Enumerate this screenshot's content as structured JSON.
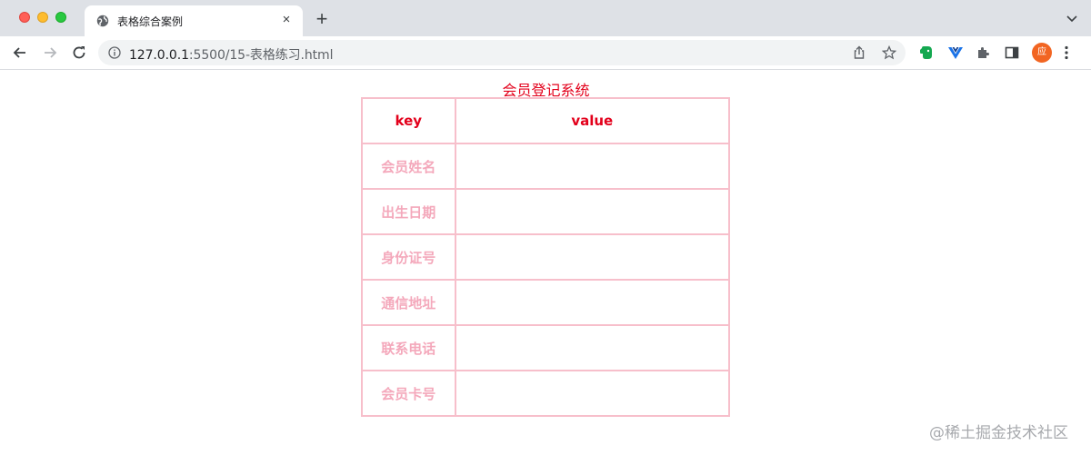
{
  "browser": {
    "tab_title": "表格综合案例",
    "tab_close": "×",
    "new_tab": "+",
    "url_host": "127.0.0.1",
    "url_rest": ":5500/15-表格练习.html",
    "profile_initial": "应"
  },
  "page": {
    "caption": "会员登记系统",
    "headers": {
      "key": "key",
      "value": "value"
    },
    "rows": [
      {
        "key": "会员姓名",
        "value": ""
      },
      {
        "key": "出生日期",
        "value": ""
      },
      {
        "key": "身份证号",
        "value": ""
      },
      {
        "key": "通信地址",
        "value": ""
      },
      {
        "key": "联系电话",
        "value": ""
      },
      {
        "key": "会员卡号",
        "value": ""
      }
    ],
    "colors": {
      "caption": "#e3001b",
      "header": "#e3001b",
      "key_text": "#f4a8bb",
      "border": "#f7bfcb"
    }
  },
  "watermark": "@稀土掘金技术社区"
}
